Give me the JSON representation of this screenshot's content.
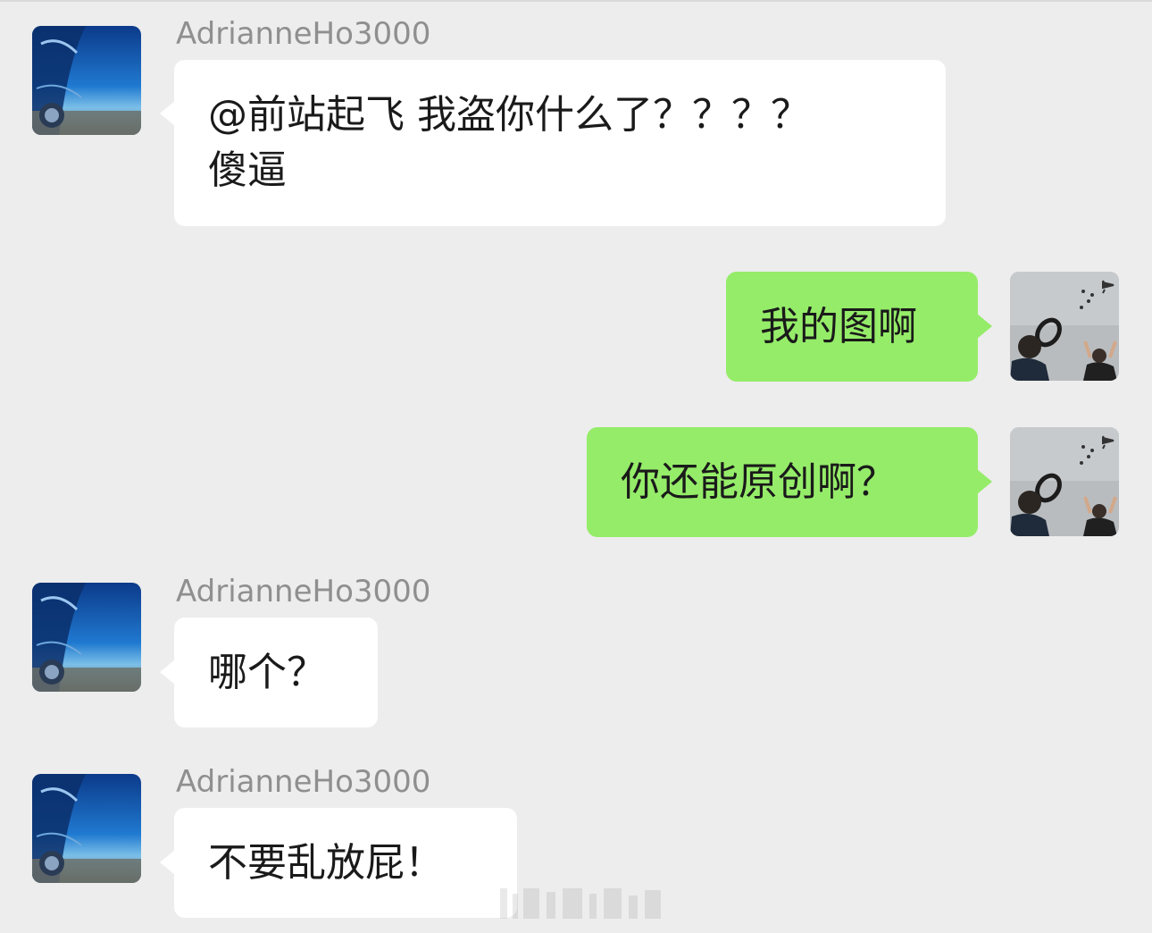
{
  "chat": {
    "messages": [
      {
        "direction": "incoming",
        "sender": "AdrianneHo3000",
        "avatar_icon": "fighter-jet-cockpit-avatar",
        "lines": [
          "@前站起飞 我盗你什么了？？？？",
          "傻逼"
        ]
      },
      {
        "direction": "outgoing",
        "avatar_icon": "airshow-photographer-avatar",
        "lines": [
          "我的图啊"
        ]
      },
      {
        "direction": "outgoing",
        "avatar_icon": "airshow-photographer-avatar",
        "lines": [
          "你还能原创啊？"
        ]
      },
      {
        "direction": "incoming",
        "sender": "AdrianneHo3000",
        "avatar_icon": "fighter-jet-cockpit-avatar",
        "lines": [
          "哪个？"
        ]
      },
      {
        "direction": "incoming",
        "sender": "AdrianneHo3000",
        "avatar_icon": "fighter-jet-cockpit-avatar",
        "lines": [
          "不要乱放屁！"
        ]
      }
    ]
  },
  "colors": {
    "background": "#ededed",
    "incoming_bubble": "#ffffff",
    "outgoing_bubble": "#95ec69",
    "sender_name": "#8f8f8f",
    "text": "#1a1a1a"
  }
}
